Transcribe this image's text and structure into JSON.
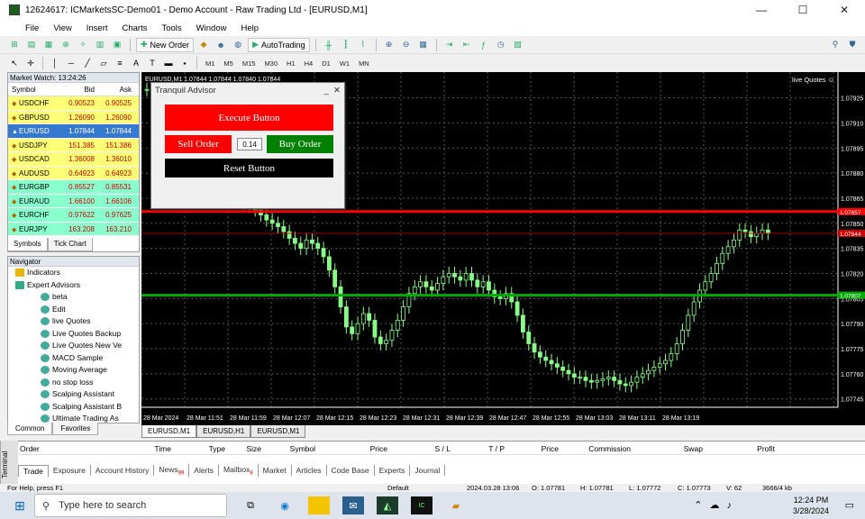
{
  "window": {
    "title": "12624617: ICMarketsSC-Demo01 - Demo Account - Raw Trading Ltd - [EURUSD,M1]",
    "min": "—",
    "max": "☐",
    "close": "✕"
  },
  "menu": [
    "File",
    "View",
    "Insert",
    "Charts",
    "Tools",
    "Window",
    "Help"
  ],
  "toolbar": {
    "new_order": "New Order",
    "auto_trading": "AutoTrading"
  },
  "timeframes": [
    "M1",
    "M5",
    "M15",
    "M30",
    "H1",
    "H4",
    "D1",
    "W1",
    "MN"
  ],
  "market_watch": {
    "title": "Market Watch: 13:24:26",
    "headers": [
      "Symbol",
      "Bid",
      "Ask"
    ],
    "rows": [
      {
        "symbol": "USDCHF",
        "bid": "0.90523",
        "ask": "0.90525",
        "bg": "#ffff77"
      },
      {
        "symbol": "GBPUSD",
        "bid": "1.26090",
        "ask": "1.26090",
        "bg": "#ffff77"
      },
      {
        "symbol": "EURUSD",
        "bid": "1.07844",
        "ask": "1.07844",
        "bg": "#3478d0",
        "sel": true
      },
      {
        "symbol": "USDJPY",
        "bid": "151.385",
        "ask": "151.386",
        "bg": "#ffff77"
      },
      {
        "symbol": "USDCAD",
        "bid": "1.36008",
        "ask": "1.36010",
        "bg": "#ffff77"
      },
      {
        "symbol": "AUDUSD",
        "bid": "0.64923",
        "ask": "0.64923",
        "bg": "#ffff77"
      },
      {
        "symbol": "EURGBP",
        "bid": "0.85527",
        "ask": "0.85531",
        "bg": "#88ffcc"
      },
      {
        "symbol": "EURAUD",
        "bid": "1.66100",
        "ask": "1.66106",
        "bg": "#88ffcc"
      },
      {
        "symbol": "EURCHF",
        "bid": "0.97622",
        "ask": "0.97625",
        "bg": "#88ffcc"
      },
      {
        "symbol": "EURJPY",
        "bid": "163.208",
        "ask": "163.210",
        "bg": "#88ffcc"
      }
    ],
    "tabs": [
      "Symbols",
      "Tick Chart"
    ]
  },
  "navigator": {
    "title": "Navigator",
    "items": [
      "Indicators",
      "Expert Advisors",
      "beta",
      "Edit",
      "live Quotes",
      "Live Quotes Backup",
      "Live Quotes New Ve",
      "MACD Sample",
      "Moving Average",
      "no stop loss",
      "Scalping Assistant",
      "Scalping Assistant B",
      "Ultimate Trading As"
    ],
    "tabs": [
      "Common",
      "Favorites"
    ]
  },
  "chart": {
    "header": "EURUSD,M1  1.07844 1.07844 1.07840 1.07844",
    "ea_label": "live Quotes ☺",
    "price_labels": [
      "1.07925",
      "1.07910",
      "1.07895",
      "1.07880",
      "1.07865",
      "1.07850",
      "1.07835",
      "1.07820",
      "1.07805",
      "1.07790",
      "1.07775",
      "1.07760",
      "1.07745"
    ],
    "time_labels": [
      "28 Mar 2024",
      "28 Mar 11:51",
      "28 Mar 11:59",
      "28 Mar 12:07",
      "28 Mar 12:15",
      "28 Mar 12:23",
      "28 Mar 12:31",
      "28 Mar 12:39",
      "28 Mar 12:47",
      "28 Mar 12:55",
      "28 Mar 13:03",
      "28 Mar 13:11",
      "28 Mar 13:19"
    ],
    "tabs": [
      "EURUSD,M1",
      "EURUSD,H1",
      "EURUSD,M1"
    ],
    "red_line": "1.07857",
    "bid_line": "1.07844",
    "green_line": "1.07807"
  },
  "ea_panel": {
    "title": "Tranquil Advisor",
    "execute": "Execute Button",
    "sell": "Sell Order",
    "lot": "0.14",
    "buy": "Buy Order",
    "reset": "Reset Button"
  },
  "terminal": {
    "side_label": "Terminal",
    "headers": [
      "Order",
      "Time",
      "Type",
      "Size",
      "Symbol",
      "Price",
      "S / L",
      "T / P",
      "Price",
      "Commission",
      "Swap",
      "Profit"
    ],
    "tabs": [
      {
        "t": "Trade"
      },
      {
        "t": "Exposure"
      },
      {
        "t": "Account History"
      },
      {
        "t": "News",
        "n": "99"
      },
      {
        "t": "Alerts"
      },
      {
        "t": "Mailbox",
        "n": "8"
      },
      {
        "t": "Market"
      },
      {
        "t": "Articles"
      },
      {
        "t": "Code Base"
      },
      {
        "t": "Experts"
      },
      {
        "t": "Journal"
      }
    ]
  },
  "status": {
    "help": "For Help, press F1",
    "profile": "Default",
    "time": "2024.03.28 13:06",
    "open": "O: 1.07781",
    "high": "H: 1.07781",
    "low": "L: 1.07772",
    "close": "C: 1.07773",
    "volume": "V: 62",
    "traffic": "3666/4 kb"
  },
  "taskbar": {
    "search": "Type here to search",
    "time": "12:24 PM",
    "date": "3/28/2024"
  }
}
